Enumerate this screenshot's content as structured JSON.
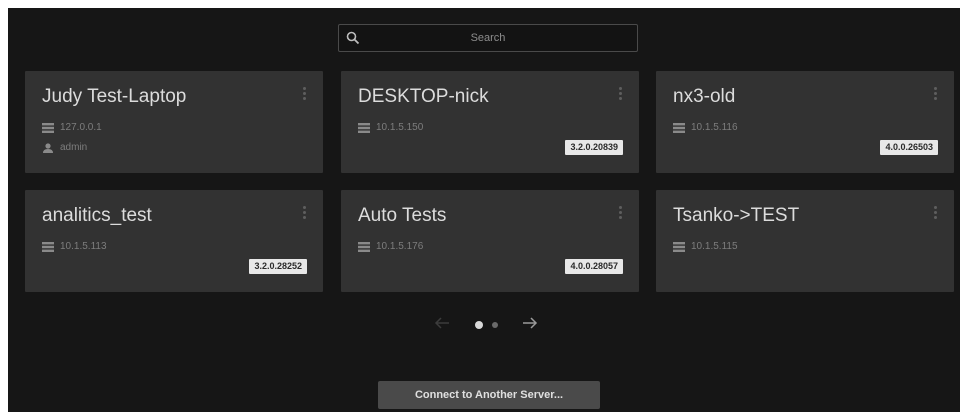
{
  "search": {
    "placeholder": "Search"
  },
  "servers": [
    {
      "name": "Judy Test-Laptop",
      "address": "127.0.0.1",
      "user": "admin",
      "version": ""
    },
    {
      "name": "DESKTOP-nick",
      "address": "10.1.5.150",
      "user": "",
      "version": "3.2.0.20839"
    },
    {
      "name": "nx3-old",
      "address": "10.1.5.116",
      "user": "",
      "version": "4.0.0.26503"
    },
    {
      "name": "analitics_test",
      "address": "10.1.5.113",
      "user": "",
      "version": "3.2.0.28252"
    },
    {
      "name": "Auto Tests",
      "address": "10.1.5.176",
      "user": "",
      "version": "4.0.0.28057"
    },
    {
      "name": "Tsanko->TEST",
      "address": "10.1.5.115",
      "user": "",
      "version": ""
    }
  ],
  "pagination": {
    "pages": 2,
    "current": 1
  },
  "connect_button": {
    "label": "Connect to Another Server..."
  },
  "icons": {
    "search": "search-icon",
    "server": "server-icon",
    "user": "user-icon",
    "menu": "more-vertical-icon",
    "prev": "arrow-left-icon",
    "next": "arrow-right-icon"
  },
  "colors": {
    "background": "#161616",
    "card": "#323232",
    "badge": "#e8e8e8",
    "button": "#4a4a4a"
  }
}
